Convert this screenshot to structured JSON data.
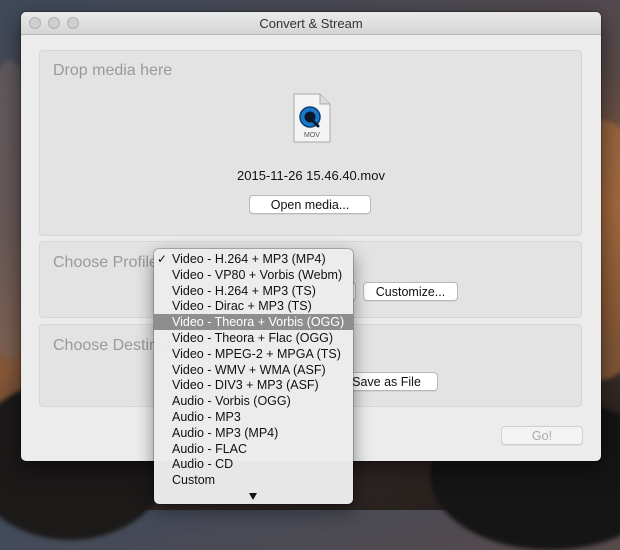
{
  "window": {
    "title": "Convert & Stream"
  },
  "source": {
    "label": "Drop media here",
    "file_badge": "MOV",
    "filename": "2015-11-26 15.46.40.mov",
    "open_button": "Open media..."
  },
  "profile": {
    "label": "Choose Profile",
    "customize_button": "Customize...",
    "menu": {
      "checked_glyph": "✓",
      "items": [
        "Video - H.264 + MP3 (MP4)",
        "Video - VP80 + Vorbis (Webm)",
        "Video - H.264 + MP3 (TS)",
        "Video - Dirac + MP3 (TS)",
        "Video - Theora + Vorbis (OGG)",
        "Video - Theora + Flac (OGG)",
        "Video - MPEG-2 + MPGA (TS)",
        "Video - WMV + WMA (ASF)",
        "Video - DIV3 + MP3 (ASF)",
        "Audio - Vorbis (OGG)",
        "Audio - MP3",
        "Audio - MP3 (MP4)",
        "Audio - FLAC",
        "Audio - CD",
        "Custom"
      ],
      "checked_index": 0,
      "highlighted_index": 4
    }
  },
  "destination": {
    "label": "Choose Destination",
    "save_button": "Save as File"
  },
  "go_button": "Go!"
}
